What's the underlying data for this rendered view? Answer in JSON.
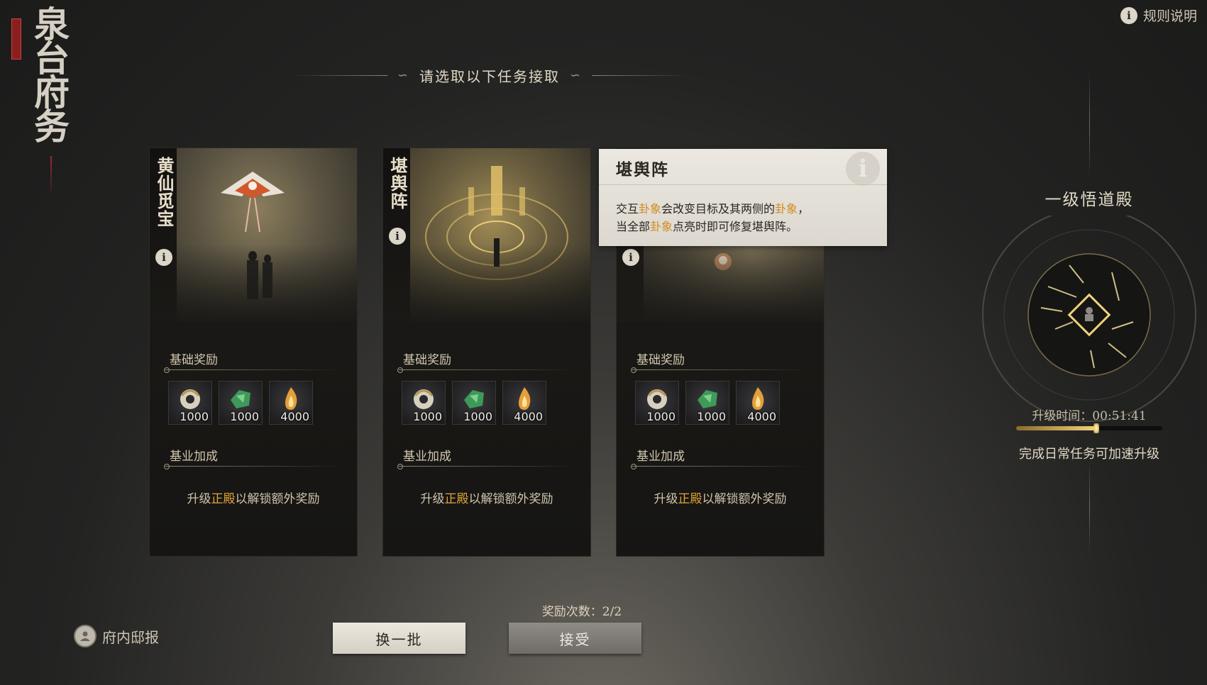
{
  "logo": {
    "title": "泉台府务"
  },
  "header": {
    "rules_label": "规则说明",
    "heading": "请选取以下任务接取"
  },
  "cards": [
    {
      "title": "黄仙觅宝",
      "base_label": "基础奖励",
      "rewards": [
        {
          "icon": "jade-disc-icon",
          "amount": "1000"
        },
        {
          "icon": "green-jade-icon",
          "amount": "1000"
        },
        {
          "icon": "flame-icon",
          "amount": "4000"
        }
      ],
      "bonus_label": "基业加成",
      "unlock_pre": "升级",
      "unlock_hl": "正殿",
      "unlock_post": "以解锁额外奖励"
    },
    {
      "title": "堪舆阵",
      "base_label": "基础奖励",
      "rewards": [
        {
          "icon": "jade-disc-icon",
          "amount": "1000"
        },
        {
          "icon": "green-jade-icon",
          "amount": "1000"
        },
        {
          "icon": "flame-icon",
          "amount": "4000"
        }
      ],
      "bonus_label": "基业加成",
      "unlock_pre": "升级",
      "unlock_hl": "正殿",
      "unlock_post": "以解锁额外奖励"
    },
    {
      "title": "",
      "base_label": "基础奖励",
      "rewards": [
        {
          "icon": "jade-disc-icon",
          "amount": "1000"
        },
        {
          "icon": "green-jade-icon",
          "amount": "1000"
        },
        {
          "icon": "flame-icon",
          "amount": "4000"
        }
      ],
      "bonus_label": "基业加成",
      "unlock_pre": "升级",
      "unlock_hl": "正殿",
      "unlock_post": "以解锁额外奖励"
    }
  ],
  "tooltip": {
    "title": "堪舆阵",
    "l1_a": "交互",
    "l1_hl1": "卦象",
    "l1_b": "会改变目标及其两侧的",
    "l1_hl2": "卦象",
    "l1_c": "，",
    "l2_a": "当全部",
    "l2_hl": "卦象",
    "l2_b": "点亮时即可修复堪舆阵。"
  },
  "hall": {
    "title": "一级悟道殿",
    "upgrade_time": "升级时间：00:51:41",
    "progress": 0.55,
    "note": "完成日常任务可加速升级"
  },
  "footer": {
    "news_label": "府内邸报",
    "reward_count": "奖励次数：2/2",
    "swap_button": "换一批",
    "accept_button": "接受"
  },
  "colors": {
    "highlight": "#e2a63a",
    "tooltip_highlight": "#d08d20",
    "gold": "#f0d27a"
  }
}
